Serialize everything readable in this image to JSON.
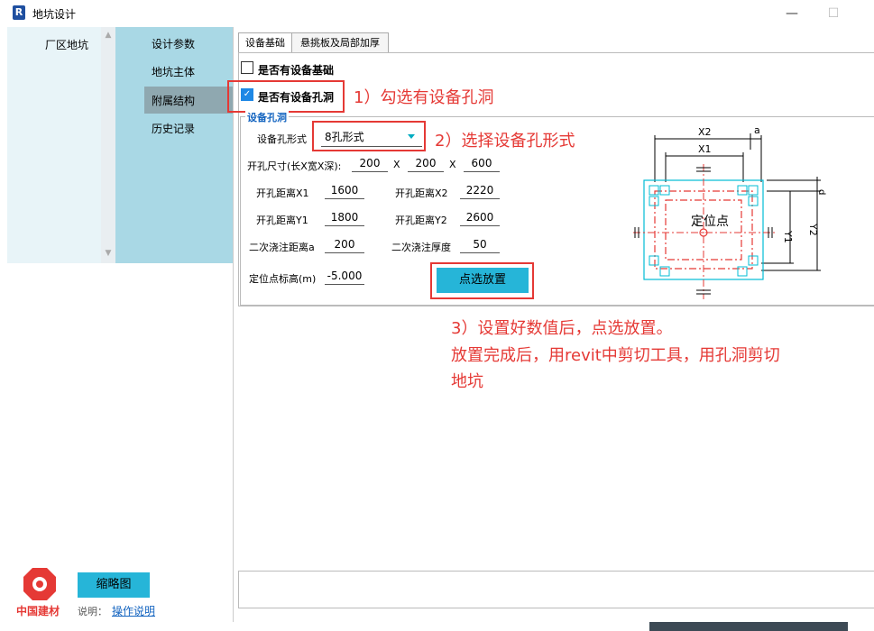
{
  "window": {
    "title": "地坑设计",
    "app_icon": "R"
  },
  "nav_primary": {
    "items": [
      "厂区地坑"
    ]
  },
  "nav_secondary": {
    "items": [
      "设计参数",
      "地坑主体",
      "附属结构",
      "历史记录"
    ],
    "active": "附属结构"
  },
  "tabs": [
    "设备基础",
    "悬挑板及局部加厚"
  ],
  "checkboxes": {
    "foundation": {
      "label": "是否有设备基础",
      "checked": false
    },
    "hole": {
      "label": "是否有设备孔洞",
      "checked": true
    }
  },
  "group": {
    "title": "设备孔洞"
  },
  "form": {
    "hole_type_label": "设备孔形式",
    "hole_type_value": "8孔形式",
    "size_label": "开孔尺寸(长X宽X深):",
    "size_l": "200",
    "size_w": "200",
    "size_d": "600",
    "sep": "X",
    "x1_label": "开孔距离X1",
    "x1": "1600",
    "x2_label": "开孔距离X2",
    "x2": "2220",
    "y1_label": "开孔距离Y1",
    "y1": "1800",
    "y2_label": "开孔距离Y2",
    "y2": "2600",
    "a_label": "二次浇注距离a",
    "a": "200",
    "thick_label": "二次浇注厚度",
    "thick": "50",
    "elev_label": "定位点标高(m)",
    "elev": "-5.000"
  },
  "buttons": {
    "place": "点选放置",
    "thumbnail": "缩略图"
  },
  "annotations": {
    "a1": "1）勾选有设备孔洞",
    "a2": "2）选择设备孔形式",
    "a3_line1": "3）设置好数值后，点选放置。",
    "a3_line2": "放置完成后，用revit中剪切工具，用孔洞剪切",
    "a3_line3": "地坑"
  },
  "diagram": {
    "x2": "X2",
    "x1": "X1",
    "a": "a",
    "d": "d",
    "y1": "Y1",
    "y2": "Y2",
    "center": "定位点"
  },
  "footer": {
    "logo_text": "中国建材",
    "note_label": "说明：",
    "note_link": "操作说明"
  },
  "colors": {
    "accent": "#26b5d8",
    "annotation": "#e53935",
    "nav_bg": "#a9d8e5"
  }
}
